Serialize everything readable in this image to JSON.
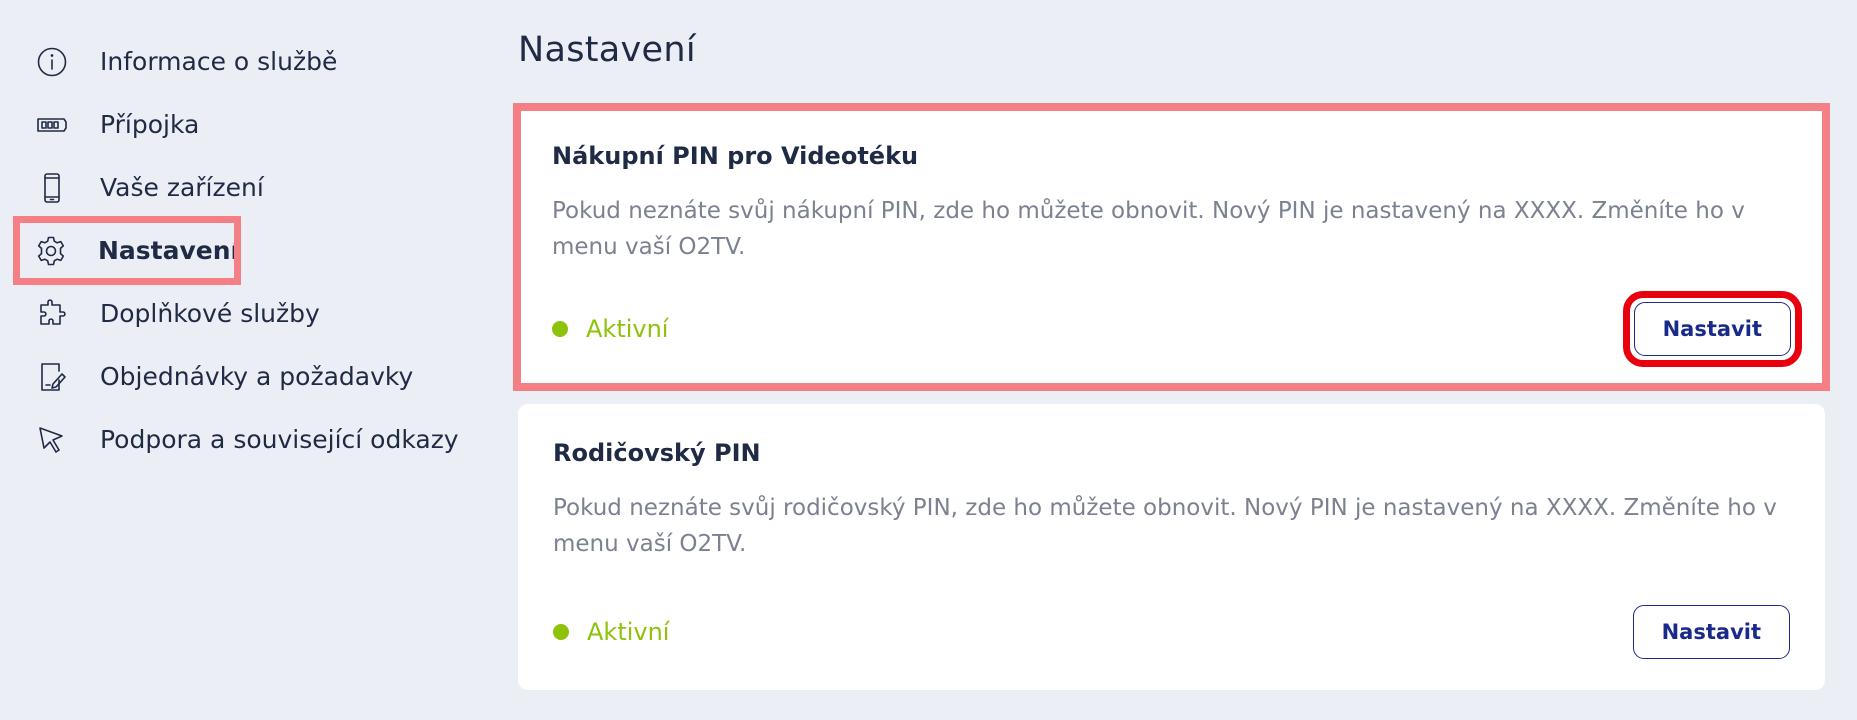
{
  "sidebar": {
    "items": [
      {
        "label": "Informace o službě",
        "icon": "info-icon"
      },
      {
        "label": "Přípojka",
        "icon": "connection-icon"
      },
      {
        "label": "Vaše zařízení",
        "icon": "phone-icon"
      },
      {
        "label": "Nastavení",
        "icon": "gear-icon",
        "active": true
      },
      {
        "label": "Doplňkové služby",
        "icon": "puzzle-icon"
      },
      {
        "label": "Objednávky a požadavky",
        "icon": "document-edit-icon"
      },
      {
        "label": "Podpora a související odkazy",
        "icon": "cursor-icon"
      }
    ]
  },
  "main": {
    "title": "Nastavení",
    "cards": [
      {
        "title": "Nákupní PIN pro Videotéku",
        "description": "Pokud neznáte svůj nákupní PIN, zde ho můžete obnovit. Nový PIN je nastavený na  XXXX. Změníte ho v menu vaší O2TV.",
        "status": "Aktivní",
        "button": "Nastavit"
      },
      {
        "title": "Rodičovský PIN",
        "description": "Pokud neznáte svůj rodičovský PIN, zde ho můžete obnovit. Nový PIN je nastavený na  XXXX. Změníte ho v menu vaší O2TV.",
        "status": "Aktivní",
        "button": "Nastavit"
      }
    ]
  },
  "colors": {
    "background": "#eceef5",
    "text": "#1f2a44",
    "muted": "#7b8190",
    "active": "#8fc20a",
    "button": "#1a2a8a",
    "highlight": "#f47f84",
    "focus": "#e8000f"
  }
}
